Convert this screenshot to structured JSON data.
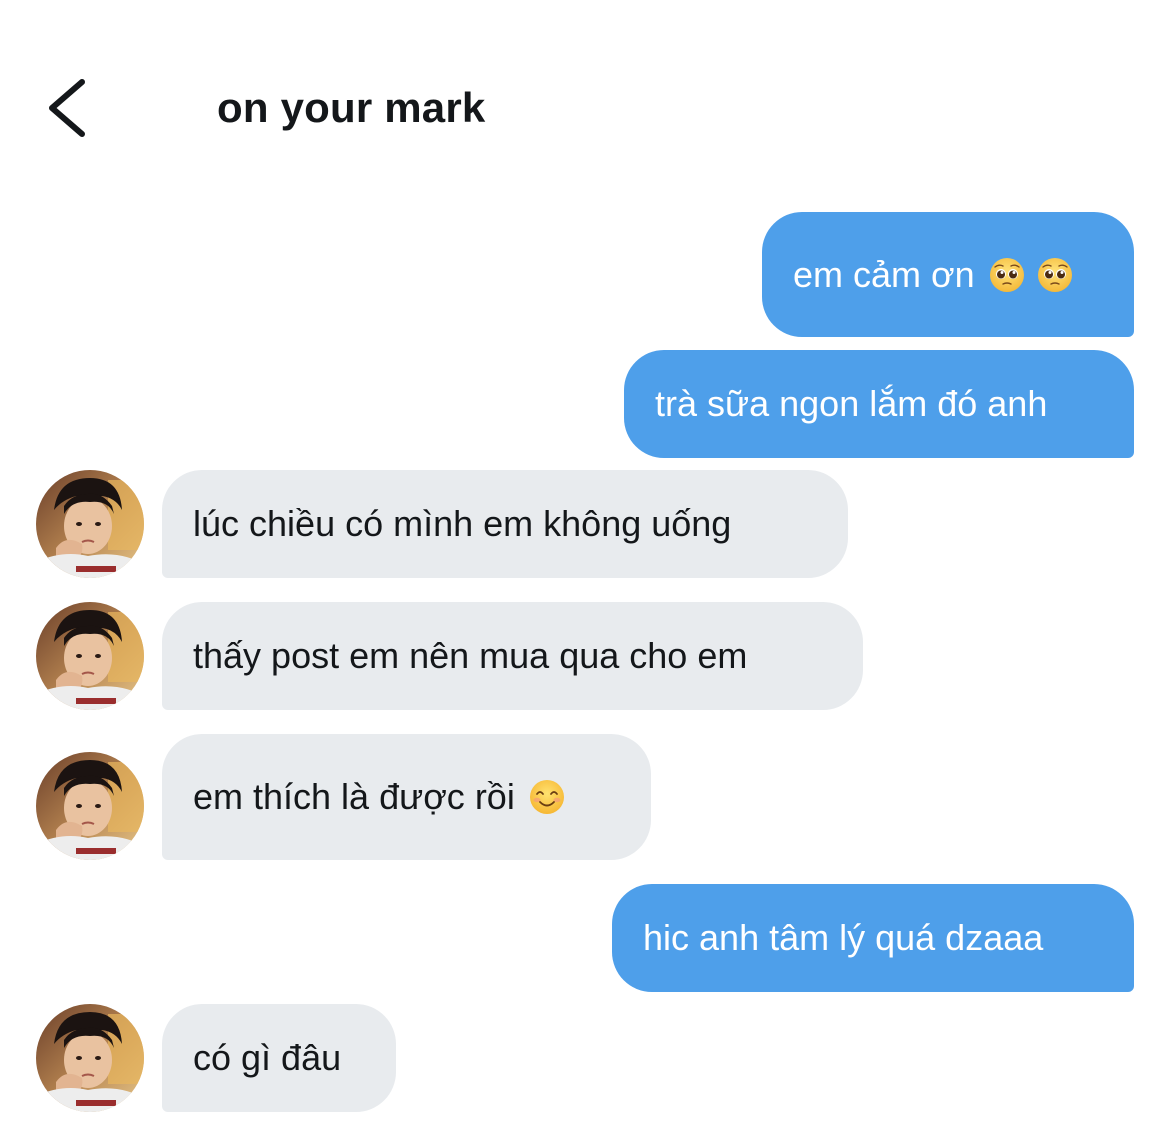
{
  "header": {
    "title": "on your mark",
    "back_icon": "chevron-left-icon"
  },
  "colors": {
    "sent_bubble": "#4e9fea",
    "received_bubble": "#e8ebee",
    "text_dark": "#14171a"
  },
  "messages": [
    {
      "side": "sent",
      "text": "em cảm ơn",
      "emoji": [
        "pleading-face-icon",
        "pleading-face-icon"
      ]
    },
    {
      "side": "sent",
      "text": "trà sữa ngon lắm đó anh"
    },
    {
      "side": "received",
      "text": "lúc chiều có mình em không uống"
    },
    {
      "side": "received",
      "text": "thấy post em nên mua qua cho em"
    },
    {
      "side": "received",
      "text": "em thích là được rồi",
      "emoji": [
        "smiling-face-icon"
      ]
    },
    {
      "side": "sent",
      "text": "hic anh tâm lý quá dzaaa"
    },
    {
      "side": "received",
      "text": "có gì đâu"
    }
  ]
}
